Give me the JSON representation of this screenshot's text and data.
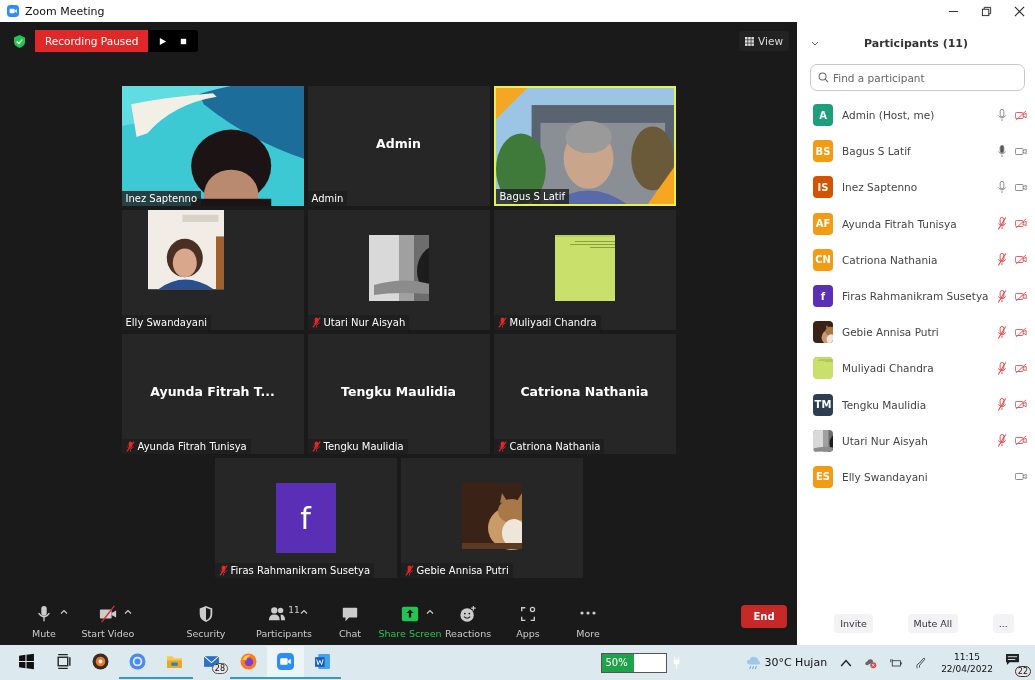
{
  "window": {
    "title": "Zoom Meeting"
  },
  "recording": {
    "label": "Recording Paused"
  },
  "view_button": {
    "label": "View"
  },
  "tiles": [
    {
      "kind": "video",
      "name": "Inez Saptenno",
      "muted": false,
      "speaking": false
    },
    {
      "kind": "name",
      "display": "Admin",
      "name": "Admin",
      "muted": false,
      "speaking": false
    },
    {
      "kind": "video",
      "name": "Bagus S Latif",
      "muted": false,
      "speaking": true
    },
    {
      "kind": "portrait",
      "name": "Elly Swandayani",
      "muted": false,
      "speaking": false
    },
    {
      "kind": "avatar",
      "name": "Utari Nur Aisyah",
      "muted": true,
      "speaking": false
    },
    {
      "kind": "avatar",
      "name": "Muliyadi Chandra",
      "muted": true,
      "speaking": false
    },
    {
      "kind": "name",
      "display": "Ayunda Fitrah T...",
      "name": "Ayunda Fitrah Tunisya",
      "muted": true,
      "speaking": false
    },
    {
      "kind": "name",
      "display": "Tengku Maulidia",
      "name": "Tengku Maulidia",
      "muted": true,
      "speaking": false
    },
    {
      "kind": "name",
      "display": "Catriona Nathania",
      "name": "Catriona Nathania",
      "muted": true,
      "speaking": false
    },
    {
      "kind": "initial",
      "display": "f",
      "color": "#5b2fb5",
      "name": "Firas Rahmanikram Susetya",
      "muted": true,
      "speaking": false
    },
    {
      "kind": "avatar",
      "name": "Gebie Annisa Putri",
      "muted": true,
      "speaking": false
    }
  ],
  "toolbar": [
    {
      "kind": "mic",
      "label": "Mute",
      "caret": true
    },
    {
      "kind": "video",
      "label": "Start Video",
      "caret": true
    },
    {
      "kind": "security",
      "label": "Security",
      "caret": false
    },
    {
      "kind": "participants",
      "label": "Participants",
      "count": "11",
      "caret": true
    },
    {
      "kind": "chat",
      "label": "Chat",
      "caret": false
    },
    {
      "kind": "share",
      "label": "Share Screen",
      "caret": true
    },
    {
      "kind": "reactions",
      "label": "Reactions",
      "caret": false
    },
    {
      "kind": "apps",
      "label": "Apps",
      "caret": false
    },
    {
      "kind": "more",
      "label": "More",
      "caret": false
    }
  ],
  "end_button": {
    "label": "End"
  },
  "participants_panel": {
    "title": "Participants (11)",
    "search": {
      "placeholder": "Find a participant"
    },
    "participants": [
      {
        "name": "Admin (Host, me)",
        "avatar": {
          "kind": "initials",
          "text": "A",
          "color": "#1f9e7e"
        },
        "audio": true,
        "muted": false,
        "speaking": false,
        "video": false
      },
      {
        "name": "Bagus S Latif",
        "avatar": {
          "kind": "initials",
          "text": "BS",
          "color": "#f39c12"
        },
        "audio": true,
        "muted": false,
        "speaking": true,
        "video": true
      },
      {
        "name": "Inez Saptenno",
        "avatar": {
          "kind": "initials",
          "text": "IS",
          "color": "#d35400"
        },
        "audio": true,
        "muted": false,
        "speaking": false,
        "video": true
      },
      {
        "name": "Ayunda Fitrah Tunisya",
        "avatar": {
          "kind": "initials",
          "text": "AF",
          "color": "#f39c12"
        },
        "audio": true,
        "muted": true,
        "speaking": false,
        "video": false
      },
      {
        "name": "Catriona Nathania",
        "avatar": {
          "kind": "initials",
          "text": "CN",
          "color": "#f39c12"
        },
        "audio": true,
        "muted": true,
        "speaking": false,
        "video": false
      },
      {
        "name": "Firas Rahmanikram Susetya",
        "avatar": {
          "kind": "initials",
          "text": "f",
          "color": "#5b2fb5"
        },
        "audio": true,
        "muted": true,
        "speaking": false,
        "video": false
      },
      {
        "name": "Gebie Annisa Putri",
        "audio": true,
        "muted": true,
        "speaking": false,
        "video": false
      },
      {
        "name": "Muliyadi Chandra",
        "audio": true,
        "muted": true,
        "speaking": false,
        "video": false
      },
      {
        "name": "Tengku Maulidia",
        "avatar": {
          "kind": "initials",
          "text": "TM",
          "color": "#2c3e50"
        },
        "audio": true,
        "muted": true,
        "speaking": false,
        "video": false
      },
      {
        "name": "Utari Nur Aisyah",
        "audio": true,
        "muted": true,
        "speaking": false,
        "video": false
      },
      {
        "name": "Elly Swandayani",
        "avatar": {
          "kind": "initials",
          "text": "ES",
          "color": "#f39c12"
        },
        "audio": false,
        "video": true
      }
    ],
    "buttons": [
      "Invite",
      "Mute All",
      "..."
    ]
  },
  "taskbar": {
    "apps": [
      {
        "kind": "start",
        "running": false,
        "selected": false
      },
      {
        "kind": "taskview",
        "running": false,
        "selected": false
      },
      {
        "kind": "media",
        "running": false,
        "selected": false
      },
      {
        "kind": "chrome",
        "running": true,
        "selected": false
      },
      {
        "kind": "files",
        "running": true,
        "selected": false
      },
      {
        "kind": "mail",
        "running": false,
        "selected": false,
        "badge": "28"
      },
      {
        "kind": "firefox",
        "running": true,
        "selected": false
      },
      {
        "kind": "zoom",
        "running": true,
        "selected": true
      },
      {
        "kind": "word",
        "running": true,
        "selected": false
      }
    ],
    "battery": {
      "label": "50%",
      "level": 0.5
    },
    "weather": "30°C Hujan",
    "time": "11:15",
    "date": "22/04/2022",
    "notifications": "22"
  }
}
